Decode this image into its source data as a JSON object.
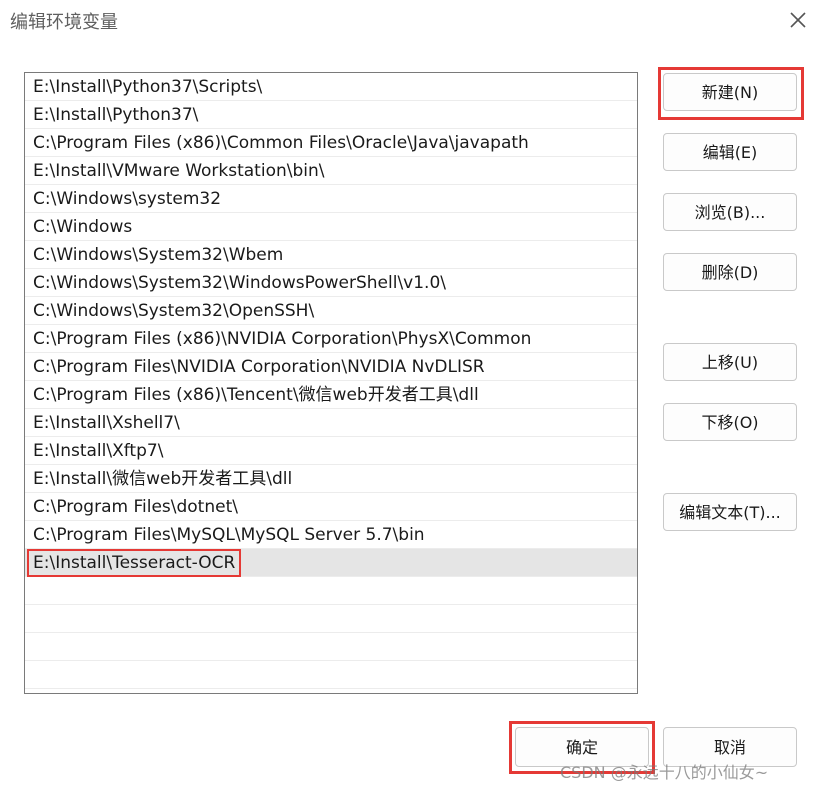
{
  "window": {
    "title": "编辑环境变量",
    "close_icon": "close-icon"
  },
  "paths": [
    "E:\\Install\\Python37\\Scripts\\",
    "E:\\Install\\Python37\\",
    "C:\\Program Files (x86)\\Common Files\\Oracle\\Java\\javapath",
    "E:\\Install\\VMware Workstation\\bin\\",
    "C:\\Windows\\system32",
    "C:\\Windows",
    "C:\\Windows\\System32\\Wbem",
    "C:\\Windows\\System32\\WindowsPowerShell\\v1.0\\",
    "C:\\Windows\\System32\\OpenSSH\\",
    "C:\\Program Files (x86)\\NVIDIA Corporation\\PhysX\\Common",
    "C:\\Program Files\\NVIDIA Corporation\\NVIDIA NvDLISR",
    "C:\\Program Files (x86)\\Tencent\\微信web开发者工具\\dll",
    "E:\\Install\\Xshell7\\",
    "E:\\Install\\Xftp7\\",
    "E:\\Install\\微信web开发者工具\\dll",
    "C:\\Program Files\\dotnet\\",
    "C:\\Program Files\\MySQL\\MySQL Server 5.7\\bin",
    "E:\\Install\\Tesseract-OCR"
  ],
  "selected_index": 17,
  "buttons": {
    "new": "新建(N)",
    "edit": "编辑(E)",
    "browse": "浏览(B)...",
    "delete": "删除(D)",
    "move_up": "上移(U)",
    "move_down": "下移(O)",
    "edit_text": "编辑文本(T)..."
  },
  "footer": {
    "ok": "确定",
    "cancel": "取消"
  },
  "watermark": "CSDN @永远十八的小仙女~",
  "colors": {
    "highlight": "#e53935",
    "selected_row": "#e5e5e5"
  }
}
